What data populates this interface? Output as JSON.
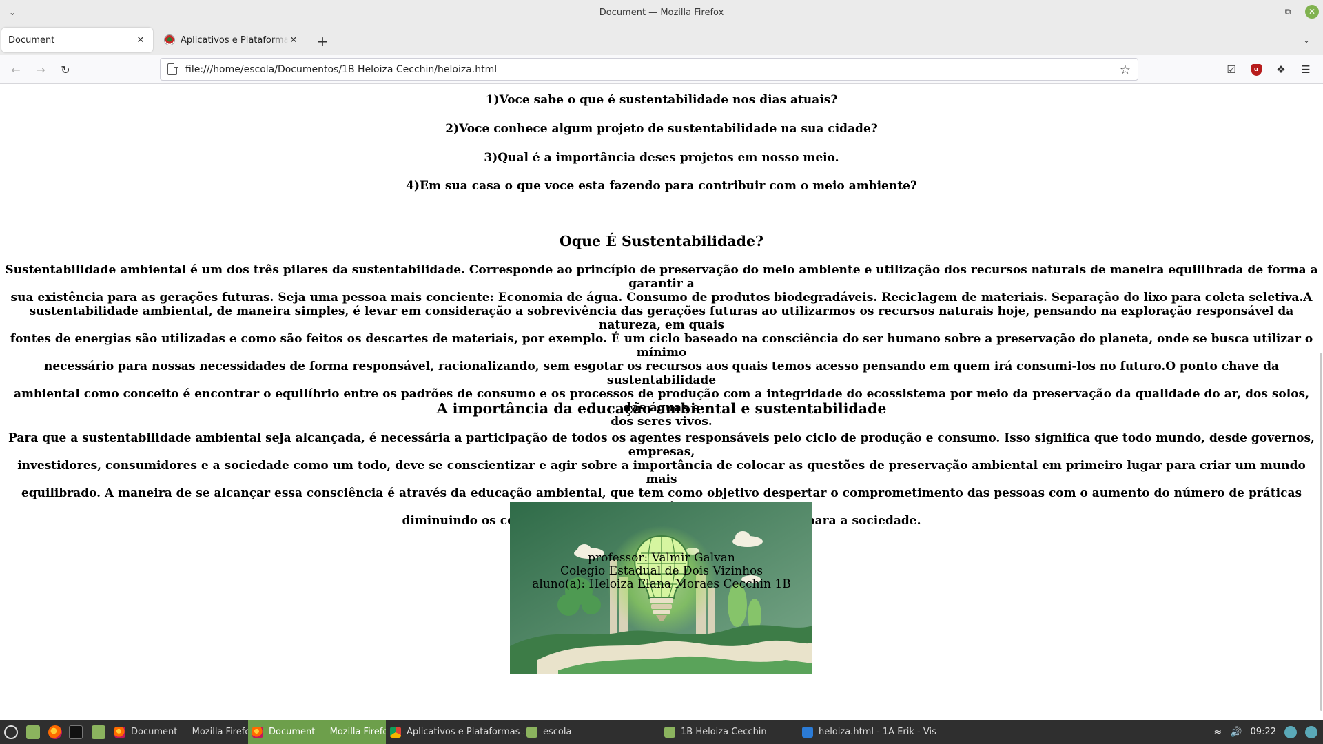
{
  "window": {
    "title": "Document — Mozilla Firefox"
  },
  "tabs": [
    {
      "label": "Document",
      "active": true
    },
    {
      "label": "Aplicativos e Plataformas Educacionais",
      "active": false
    }
  ],
  "navbar": {
    "url": "file:///home/escola/Documentos/1B Heloiza Cecchin/heloiza.html"
  },
  "page": {
    "questions": [
      "1)Voce sabe o que é sustentabilidade nos dias atuais?",
      "2)Voce conhece algum projeto de sustentabilidade na sua cidade?",
      "3)Qual é a importância deses projetos em nosso meio.",
      "4)Em sua casa o que voce esta fazendo para contribuir com o meio ambiente?"
    ],
    "section1": {
      "heading": "Oque É Sustentabilidade?",
      "lines": [
        "Sustentabilidade ambiental é um dos três pilares da sustentabilidade. Corresponde ao princípio de preservação do meio ambiente e utilização dos recursos naturais de maneira equilibrada de forma a garantir a",
        "sua existência para as gerações futuras. Seja uma pessoa mais conciente: Economia de água. Consumo de produtos biodegradáveis. Reciclagem de materiais. Separação do lixo para coleta seletiva.A",
        "sustentabilidade ambiental, de maneira simples, é levar em consideração a sobrevivência das gerações futuras ao utilizarmos os recursos naturais hoje, pensando na exploração responsável da natureza, em quais",
        "fontes de energias são utilizadas e como são feitos os descartes de materiais, por exemplo. É um ciclo baseado na consciência do ser humano sobre a preservação do planeta, onde se busca utilizar o mínimo",
        "necessário para nossas necessidades de forma responsável, racionalizando, sem esgotar os recursos aos quais temos acesso pensando em quem irá consumi-los no futuro.O ponto chave da sustentabilidade",
        "ambiental como conceito é encontrar o equilíbrio entre os padrões de consumo e os processos de produção com a integridade do ecossistema por meio da preservação da qualidade do ar, dos solos, das águas e",
        "dos seres vivos."
      ]
    },
    "section2": {
      "heading": "A importância da educação ambiental e sustentabilidade",
      "lines": [
        "Para que a sustentabilidade ambiental seja alcançada, é necessária a participação de todos os agentes responsáveis pelo ciclo de produção e consumo. Isso significa que todo mundo, desde governos, empresas,",
        "investidores, consumidores e a sociedade como um todo, deve se conscientizar e agir sobre a importância de colocar as questões de preservação ambiental em primeiro lugar para criar um mundo mais",
        "equilibrado. A maneira de se alcançar essa consciência é através da educação ambiental, que tem como objetivo despertar o comprometimento das pessoas com o aumento do número de práticas sustentáveis,",
        "diminuindo os comportamentos prejudiciais para o planeta e para a sociedade."
      ]
    },
    "footer": {
      "professor": "professor: Valmir Galvan",
      "school": "Colegio Estadual de Dois Vizinhos",
      "student": "aluno(a): Heloiza Elana Moraes Cecchin 1B"
    }
  },
  "taskbar": {
    "items": [
      {
        "label": "Document — Mozilla Firefox",
        "active": false
      },
      {
        "label": "Document — Mozilla Firefox",
        "active": true
      },
      {
        "label": "Aplicativos e Plataformas ...",
        "active": false
      },
      {
        "label": "escola",
        "active": false
      },
      {
        "label": "1B Heloiza Cecchin",
        "active": false
      },
      {
        "label": "heloiza.html - 1A Erik - Vis...",
        "active": false
      }
    ],
    "clock": "09:22"
  },
  "colors": {
    "taskbar_bg": "#2f2f2f",
    "taskbar_active": "#6d9f4b",
    "close_button": "#80b24f"
  }
}
